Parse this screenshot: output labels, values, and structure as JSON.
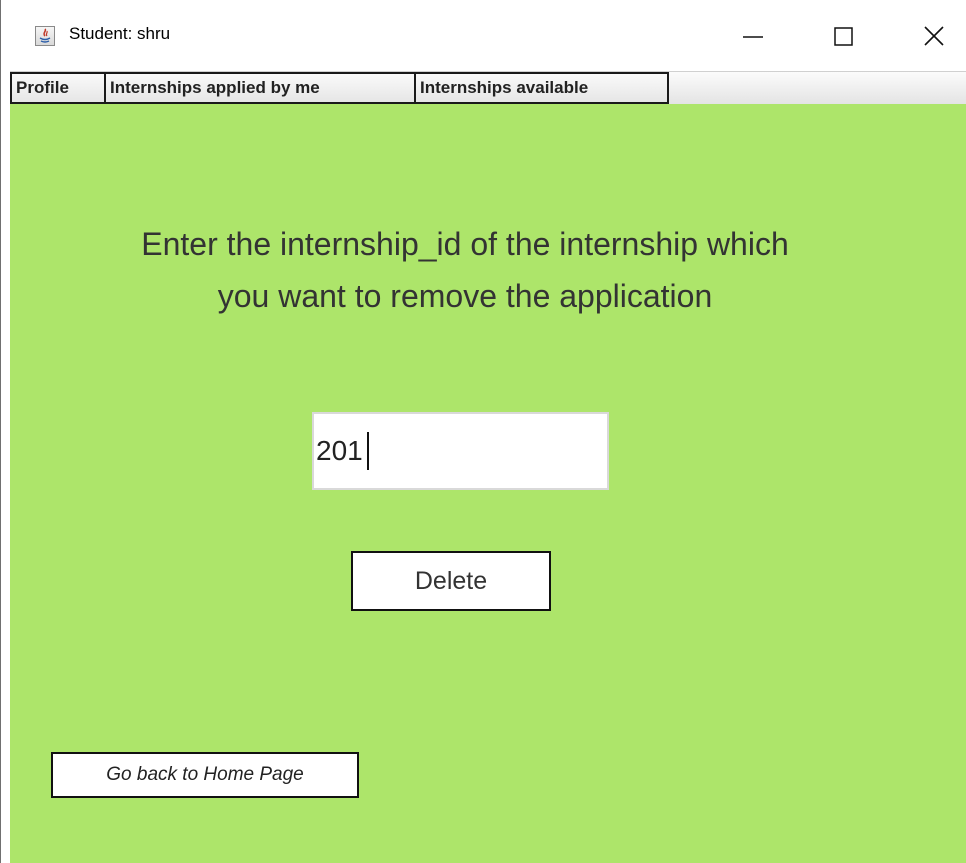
{
  "window": {
    "title": "Student: shru",
    "controls": {
      "minimize": "minimize-icon",
      "maximize": "maximize-icon",
      "close": "close-icon"
    }
  },
  "menu": {
    "items": [
      {
        "label": "Profile"
      },
      {
        "label": "Internships applied by me"
      },
      {
        "label": "Internships available"
      }
    ]
  },
  "main": {
    "background": "#ade56a",
    "heading_line1": "Enter the internship_id of the internship which",
    "heading_line2": "you want to remove the application",
    "internship_id_value": "201",
    "delete_label": "Delete",
    "home_label": "Go back to Home Page"
  }
}
